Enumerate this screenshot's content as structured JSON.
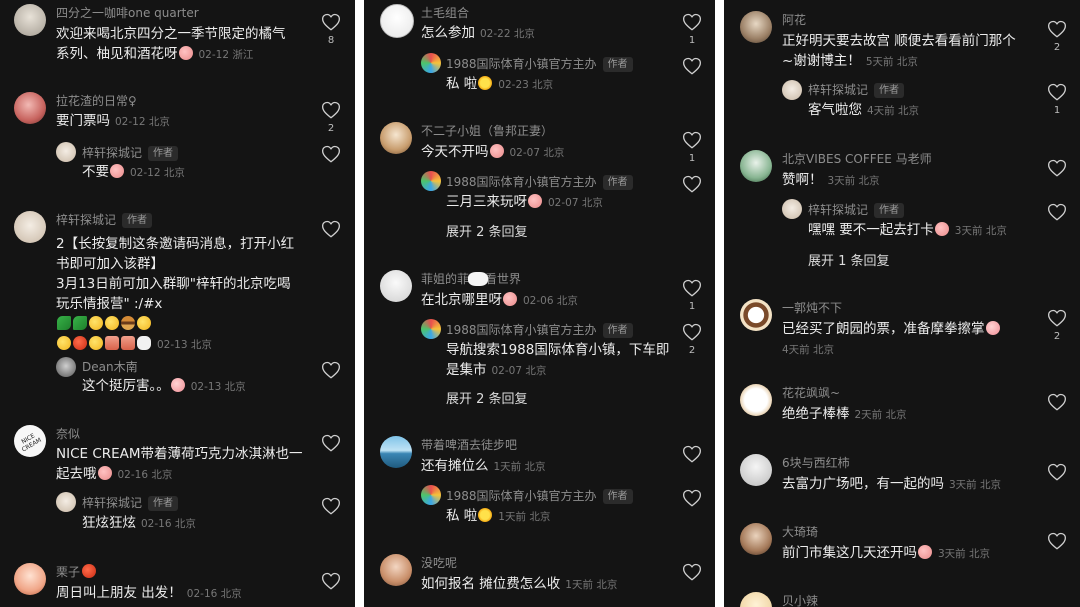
{
  "column1": {
    "comments": [
      {
        "user": "四分之一咖啡one quarter",
        "lines": [
          "欢迎来喝北京四分之一季节限定的橘气",
          "系列、柚见和酒花呀"
        ],
        "date": "02-12",
        "location": "浙江",
        "likes": "8"
      },
      {
        "user": "拉花渣的日常♀",
        "lines": [
          "要门票吗"
        ],
        "date": "02-12",
        "location": "北京",
        "likes": "2",
        "reply": {
          "user": "梓轩探城记",
          "tag": "作者",
          "text": "不要",
          "date": "02-12",
          "location": "北京"
        }
      },
      {
        "user": "梓轩探城记",
        "tag": "作者",
        "lines": [
          "2【长按复制这条邀请码消息，打开小红",
          "书即可加入该群】",
          "3月13日前可加入群聊\"梓轩的北京吃喝",
          "玩乐情报营\" :/#x"
        ],
        "date": "02-13",
        "location": "北京",
        "reply": {
          "user": "Dean木南",
          "text": "这个挺厉害。。",
          "date": "02-13",
          "location": "北京"
        }
      },
      {
        "user": "奈似",
        "lines": [
          "NICE CREAM带着薄荷巧克力冰淇淋也一",
          "起去哦"
        ],
        "date": "02-16",
        "location": "北京",
        "reply": {
          "user": "梓轩探城记",
          "tag": "作者",
          "text": "狂炫狂炫",
          "date": "02-16",
          "location": "北京"
        }
      },
      {
        "user": "栗子",
        "lines": [
          "周日叫上朋友 出发！"
        ],
        "date": "02-16",
        "location": "北京"
      }
    ]
  },
  "column2": {
    "comments": [
      {
        "user": "土毛组合",
        "lines": [
          "怎么参加"
        ],
        "date": "02-22",
        "location": "北京",
        "likes": "1",
        "reply": {
          "user": "1988国际体育小镇官方主办",
          "tag": "作者",
          "text": "私 啦",
          "date": "02-23",
          "location": "北京"
        }
      },
      {
        "user": "不二子小姐（鲁邦正妻）",
        "lines": [
          "今天不开吗"
        ],
        "date": "02-07",
        "location": "北京",
        "likes": "1",
        "reply": {
          "user": "1988国际体育小镇官方主办",
          "tag": "作者",
          "text": "三月三来玩呀",
          "date": "02-07",
          "location": "北京"
        },
        "expand": "展开 2 条回复"
      },
      {
        "user": "菲姐的菲眼 看世界",
        "lines": [
          "在北京哪里呀"
        ],
        "date": "02-06",
        "location": "北京",
        "likes": "1",
        "reply": {
          "user": "1988国际体育小镇官方主办",
          "tag": "作者",
          "lines": [
            "导航搜索1988国际体育小镇，下车即",
            "是集市"
          ],
          "date": "02-07",
          "location": "北京",
          "likes": "2"
        },
        "expand": "展开 2 条回复"
      },
      {
        "user": "带着啤酒去徒步吧",
        "lines": [
          "还有摊位么"
        ],
        "date": "1天前",
        "location": "北京",
        "reply": {
          "user": "1988国际体育小镇官方主办",
          "tag": "作者",
          "text": "私 啦",
          "date": "1天前",
          "location": "北京"
        }
      },
      {
        "user": "没吃呢",
        "lines": [
          "如何报名 摊位费怎么收"
        ],
        "date": "1天前",
        "location": "北京"
      }
    ]
  },
  "column3": {
    "comments": [
      {
        "user": "阿花",
        "lines": [
          "正好明天要去故宫 顺便去看看前门那个",
          "~谢谢博主！"
        ],
        "date": "5天前",
        "location": "北京",
        "likes": "2",
        "reply": {
          "user": "梓轩探城记",
          "tag": "作者",
          "text": "客气啦您",
          "date": "4天前",
          "location": "北京",
          "likes": "1"
        }
      },
      {
        "user": "北京VIBES COFFEE 马老师",
        "lines": [
          "赞啊！"
        ],
        "date": "3天前",
        "location": "北京",
        "reply": {
          "user": "梓轩探城记",
          "tag": "作者",
          "text": "嘿嘿 要不一起去打卡",
          "date": "3天前",
          "location": "北京"
        },
        "expand": "展开 1 条回复"
      },
      {
        "user": "一郭炖不下",
        "lines": [
          "已经买了朗园的票，准备摩拳擦掌"
        ],
        "date": "4天前",
        "location": "北京",
        "likes": "2"
      },
      {
        "user": "花花飒飒~",
        "lines": [
          "绝绝子棒棒"
        ],
        "date": "2天前",
        "location": "北京"
      },
      {
        "user": "6块与西红柿",
        "lines": [
          "去富力广场吧，有一起的吗"
        ],
        "date": "3天前",
        "location": "北京"
      },
      {
        "user": "大琦琦",
        "lines": [
          "前门市集这几天还开吗"
        ],
        "date": "3天前",
        "location": "北京"
      },
      {
        "user": "贝小辣",
        "lines": [],
        "date": "",
        "location": ""
      }
    ]
  },
  "avatar_texts": {
    "nice_cream": "NICE CREAM"
  },
  "colors": {
    "background": "#141414",
    "text": "#ececec",
    "secondary": "#8d8d8d",
    "meta": "#777777"
  }
}
